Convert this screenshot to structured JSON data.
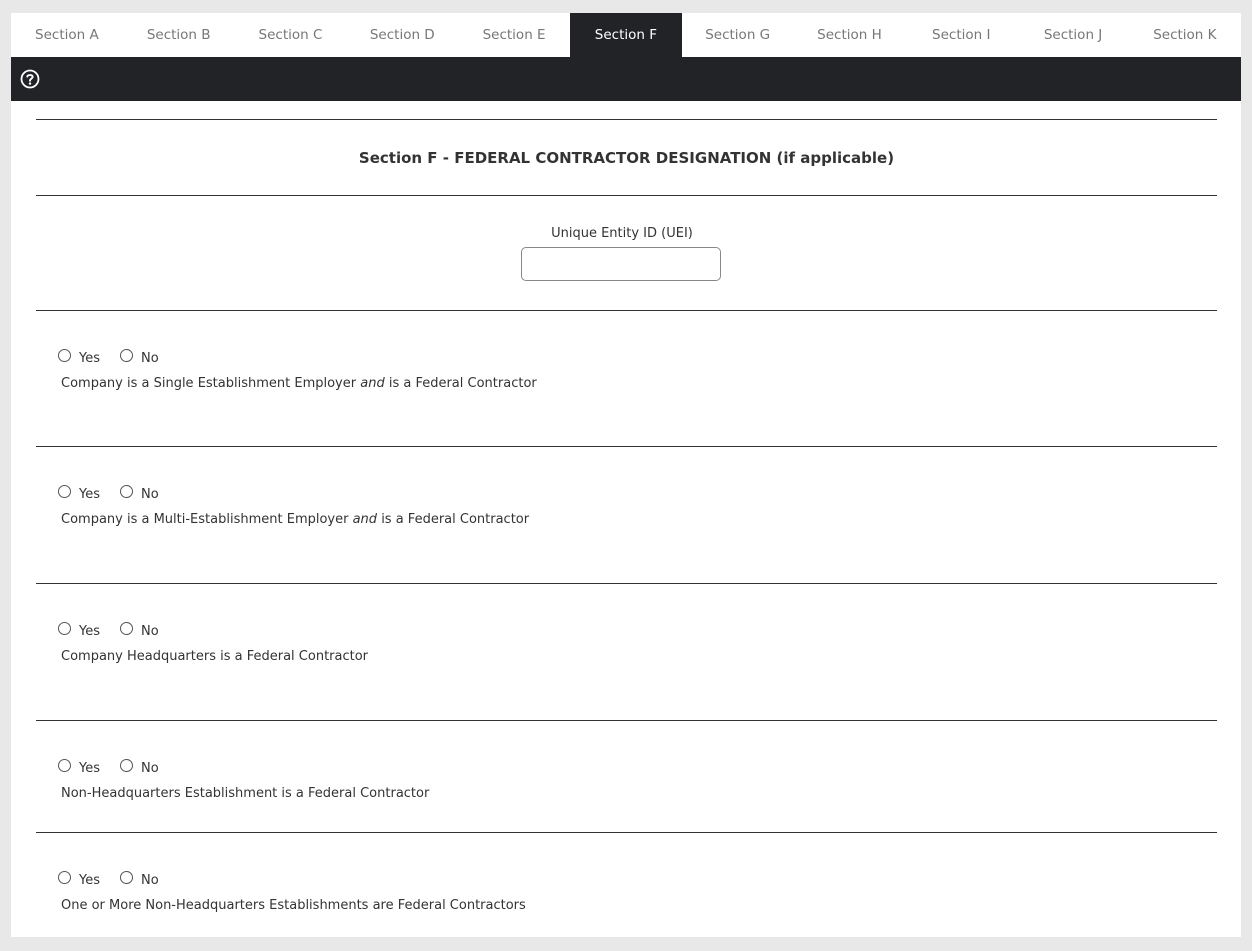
{
  "tabs": [
    {
      "label": "Section A",
      "active": false
    },
    {
      "label": "Section B",
      "active": false
    },
    {
      "label": "Section C",
      "active": false
    },
    {
      "label": "Section D",
      "active": false
    },
    {
      "label": "Section E",
      "active": false
    },
    {
      "label": "Section F",
      "active": true
    },
    {
      "label": "Section G",
      "active": false
    },
    {
      "label": "Section H",
      "active": false
    },
    {
      "label": "Section I",
      "active": false
    },
    {
      "label": "Section J",
      "active": false
    },
    {
      "label": "Section K",
      "active": false
    }
  ],
  "toolbar": {
    "help_icon": "question-circle-icon"
  },
  "section": {
    "title": "Section F - FEDERAL CONTRACTOR DESIGNATION (if applicable)",
    "uei": {
      "label": "Unique Entity ID (UEI)",
      "value": "",
      "placeholder": ""
    }
  },
  "radio_labels": {
    "yes": "Yes",
    "no": "No"
  },
  "questions": [
    {
      "pre": "Company is a Single Establishment Employer ",
      "em": "and",
      "post": " is a Federal Contractor"
    },
    {
      "pre": "Company is a Multi-Establishment Employer ",
      "em": "and",
      "post": " is a Federal Contractor"
    },
    {
      "pre": "Company Headquarters is a Federal Contractor",
      "em": "",
      "post": ""
    },
    {
      "pre": "Non-Headquarters Establishment is a Federal Contractor",
      "em": "",
      "post": ""
    },
    {
      "pre": "One or More Non-Headquarters Establishments are Federal Contractors",
      "em": "",
      "post": ""
    }
  ],
  "colors": {
    "toolbar": "#212327",
    "active_tab": "#212327",
    "background": "#e8e8e8"
  }
}
